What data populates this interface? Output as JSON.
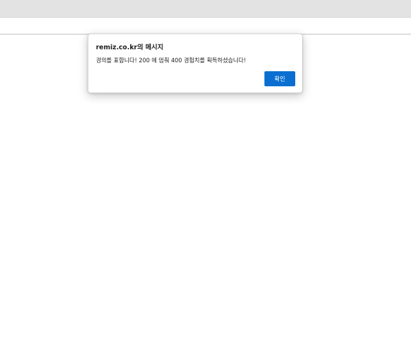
{
  "dialog": {
    "title": "remiz.co.kr의 메시지",
    "message": "경의를 표합니다! 200 에 멈춰 400 경험치를 획득하셨습니다!",
    "ok_label": "확인"
  },
  "colors": {
    "ok_button": "#0a6fd0",
    "browser_top": "#e3e3e3"
  }
}
